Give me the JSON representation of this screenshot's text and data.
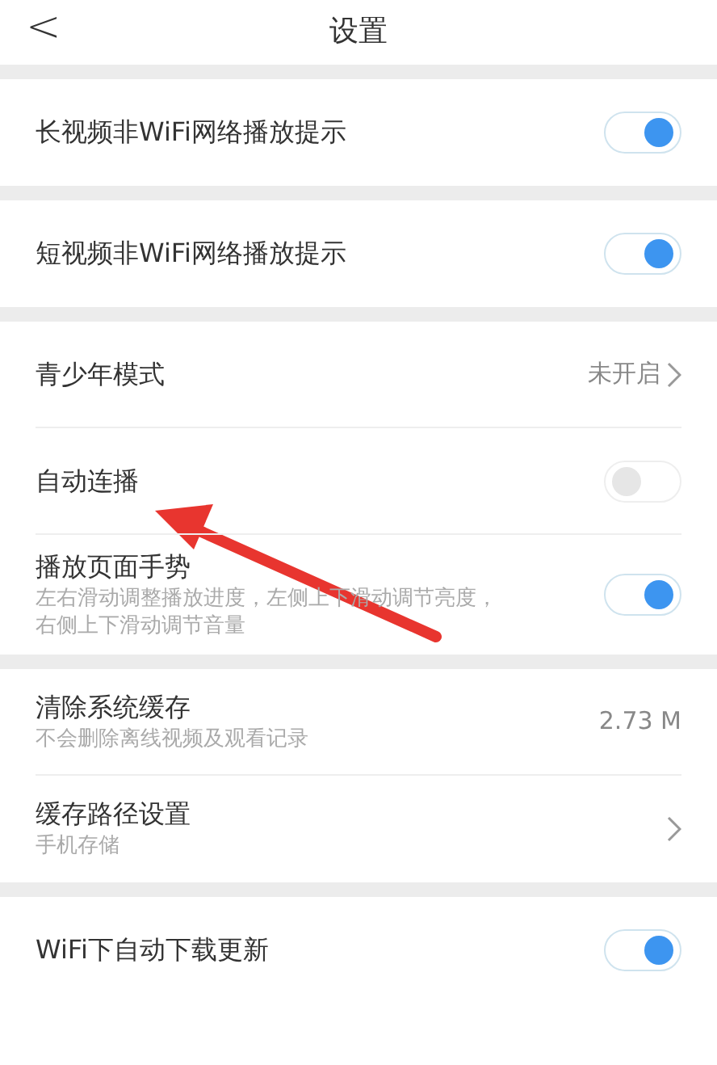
{
  "header": {
    "back": "<",
    "title": "设置"
  },
  "groups": [
    {
      "items": [
        {
          "kind": "toggle",
          "label": "长视频非WiFi网络播放提示",
          "on": true
        }
      ]
    },
    {
      "items": [
        {
          "kind": "toggle",
          "label": "短视频非WiFi网络播放提示",
          "on": true
        }
      ]
    },
    {
      "items": [
        {
          "kind": "nav",
          "label": "青少年模式",
          "value": "未开启"
        },
        {
          "kind": "toggle",
          "label": "自动连播",
          "on": false
        },
        {
          "kind": "toggle",
          "label": "播放页面手势",
          "sub": "左右滑动调整播放进度，左侧上下滑动调节亮度，右侧上下滑动调节音量",
          "on": true
        }
      ]
    },
    {
      "items": [
        {
          "kind": "value",
          "label": "清除系统缓存",
          "sub": "不会删除离线视频及观看记录",
          "value": "2.73  M"
        },
        {
          "kind": "nav",
          "label": "缓存路径设置",
          "sub": "手机存储"
        }
      ]
    },
    {
      "items": [
        {
          "kind": "toggle",
          "label": "WiFi下自动下载更新",
          "on": true
        }
      ]
    }
  ]
}
